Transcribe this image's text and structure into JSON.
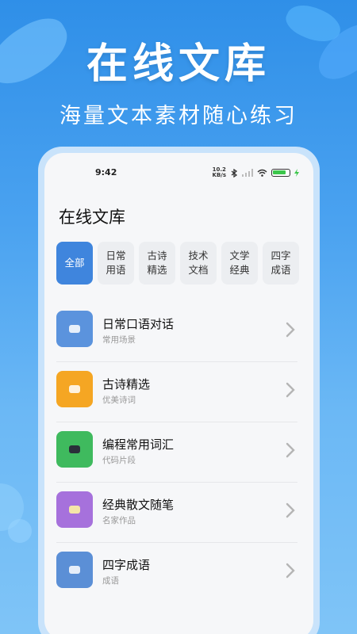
{
  "hero": {
    "title": "在线文库",
    "subtitle": "海量文本素材随心练习"
  },
  "status": {
    "time": "9:42",
    "net_speed_top": "10.2",
    "net_speed_bottom": "KB/s",
    "battery_color": "#3cc64b"
  },
  "page_title": "在线文库",
  "tabs": [
    {
      "label": "全部",
      "active": true
    },
    {
      "label": "日常用语",
      "active": false
    },
    {
      "label": "古诗精选",
      "active": false
    },
    {
      "label": "技术文档",
      "active": false
    },
    {
      "label": "文学经典",
      "active": false
    },
    {
      "label": "四字成语",
      "active": false
    }
  ],
  "items": [
    {
      "title": "日常口语对话",
      "subtitle": "常用场景",
      "color": "#5b93dd",
      "icon": "chat-bubble-icon"
    },
    {
      "title": "古诗精选",
      "subtitle": "优美诗词",
      "color": "#f5a623",
      "icon": "scroll-icon"
    },
    {
      "title": "编程常用词汇",
      "subtitle": "代码片段",
      "color": "#3fba5e",
      "icon": "laptop-icon"
    },
    {
      "title": "经典散文随笔",
      "subtitle": "名家作品",
      "color": "#a671dc",
      "icon": "pencil-note-icon"
    },
    {
      "title": "四字成语",
      "subtitle": "成语",
      "color": "#5b8fd6",
      "icon": "book-icon"
    }
  ]
}
